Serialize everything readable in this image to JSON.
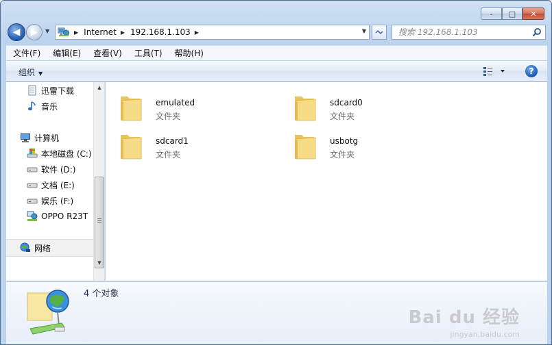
{
  "window": {
    "caption_buttons": {
      "minimize": "-",
      "maximize": "□",
      "close": "✕"
    }
  },
  "addressbar": {
    "back_glyph": "◀",
    "forward_glyph": "▶",
    "crumbs": [
      "Internet",
      "192.168.1.103"
    ],
    "search_placeholder": "搜索 192.168.1.103"
  },
  "menubar": {
    "items": [
      "文件(F)",
      "编辑(E)",
      "查看(V)",
      "工具(T)",
      "帮助(H)"
    ]
  },
  "commandbar": {
    "organize_label": "组织",
    "help_label": "?"
  },
  "navpane": {
    "items": [
      {
        "label": "迅雷下载",
        "icon": "document-icon"
      },
      {
        "label": "音乐",
        "icon": "music-icon"
      },
      {
        "label": "计算机",
        "icon": "computer-icon"
      },
      {
        "label": "本地磁盘 (C:)",
        "icon": "system-drive-icon"
      },
      {
        "label": "软件 (D:)",
        "icon": "drive-icon"
      },
      {
        "label": "文档 (E:)",
        "icon": "drive-icon"
      },
      {
        "label": "娱乐 (F:)",
        "icon": "drive-icon"
      },
      {
        "label": "OPPO R23T",
        "icon": "device-icon"
      },
      {
        "label": "网络",
        "icon": "network-icon"
      }
    ]
  },
  "content": {
    "folders": [
      {
        "name": "emulated",
        "type": "文件夹"
      },
      {
        "name": "sdcard0",
        "type": "文件夹"
      },
      {
        "name": "sdcard1",
        "type": "文件夹"
      },
      {
        "name": "usbotg",
        "type": "文件夹"
      }
    ]
  },
  "details": {
    "count_text": "4 个对象"
  },
  "watermark": {
    "main": "Bai du 经验",
    "sub": "jingyan.baidu.com"
  },
  "colors": {
    "chrome": "#bcd3ee",
    "folder": "#f2d373",
    "accent": "#2b64b6"
  }
}
